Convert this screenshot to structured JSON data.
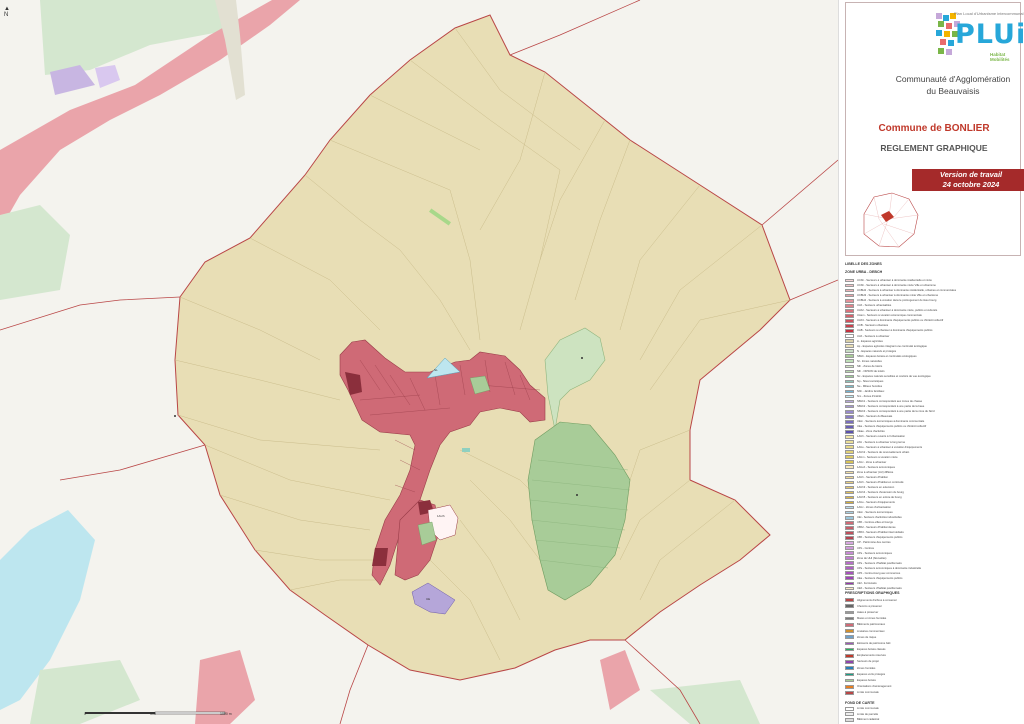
{
  "colors": {
    "background": "#f4f3ee",
    "agricultural": "#e8deb5",
    "urban": "#cf6a76",
    "urban_dark": "#b44c5a",
    "natural": "#cde3c0",
    "forest": "#a8cc98",
    "water": "#bde6ef",
    "boundary": "#b94646",
    "neighbor_urban": "#eaa4aa",
    "neighbor_natural": "#d4e7cf",
    "purple": "#b5a6d9",
    "accent": "#a52a2a"
  },
  "north_arrow": "N",
  "map_labels": {
    "zone_a": "NL",
    "zone_b": "UE",
    "zone_c": "1AUh"
  },
  "scale": {
    "start": "0",
    "mid": "500",
    "end": "1000 m"
  },
  "title_block": {
    "logo_tagline": "Plan Local d'Urbanisme intercommunal",
    "logo_word": "PLUi",
    "logo_sub_1": "Habitat",
    "logo_sub_2": "Mobilités",
    "org_line1": "Communauté d'Agglomération",
    "org_line2": "du Beauvaisis",
    "commune": "Commune de BONLIER",
    "document": "REGLEMENT GRAPHIQUE",
    "version_line1": "Version de travail",
    "version_line2": "24 octobre 2024"
  },
  "legend": {
    "title": "LIBELLE DES ZONES",
    "section_zones": "ZONE URBA - DEBCH",
    "section_prescriptions": "PRESCRIPTIONS GRAPHIQUES",
    "section_fond": "FOND DE CARTE",
    "zones": [
      {
        "color": "#f6d3d6",
        "label": "UCbh - Secteurs à urbaniser à dominante résidentielle et mixte"
      },
      {
        "color": "#f1c2c6",
        "label": "UCbh - Secteurs à urbaniser à dominante mixte Ville et urbanisme"
      },
      {
        "color": "#ecb2b7",
        "label": "UCBH2 - Secteurs à urbaniser à dominante résidentielle, urbaines et commerciales"
      },
      {
        "color": "#e7a1a8",
        "label": "UCBH3 - Secteurs à urbaniser à dominante mixte Ville et urbanisme"
      },
      {
        "color": "#e29199",
        "label": "UCBH4 - Secteurs à vocation dans le prolongement du tissu bourg"
      },
      {
        "color": "#dd818a",
        "label": "UAh - Secteurs urbanisables"
      },
      {
        "color": "#d8717b",
        "label": "UAh2 - Secteurs à urbaniser à dominante mixte, publics et culturels"
      },
      {
        "color": "#d3616c",
        "label": "UAem - Secteurs à vocation économique commerciale"
      },
      {
        "color": "#ce515d",
        "label": "UAh3 - Secteurs à dominante d'équipements publics ou d'intérêt collectif"
      },
      {
        "color": "#c9414e",
        "label": "UCB - Secteurs urbanisés"
      },
      {
        "color": "#c4313f",
        "label": "UAB - Secteurs à urbaniser à dominante d'équipements publics"
      },
      {
        "color": "#ffffff",
        "label": "UAh - Secteurs à urbaniser"
      },
      {
        "color": "#d9d0a8",
        "label": "A - Espaces agricoles"
      },
      {
        "color": "#e8deb5",
        "label": "Ap - Espaces agricoles intégrant une continuité écologique"
      },
      {
        "color": "#c7dcc3",
        "label": "N - Espaces naturels et protégés"
      },
      {
        "color": "#a8cc98",
        "label": "NBoh - Espaces boisés et continuités écologiques"
      },
      {
        "color": "#bfe0b8",
        "label": "Nl - Zones naturelles"
      },
      {
        "color": "#cde3c0",
        "label": "Nlh - Zones de loisirs"
      },
      {
        "color": "#b8d9b0",
        "label": "Nlh - ORSON de loisirs"
      },
      {
        "color": "#9fcf9a",
        "label": "Nc - Espaces naturels sensibles et couloirs de vue écologique"
      },
      {
        "color": "#8bc4b8",
        "label": "Np - Sites touristiques"
      },
      {
        "color": "#7dbec9",
        "label": "Ne - Milieux humides"
      },
      {
        "color": "#6fb3d3",
        "label": "Nbh - Jardins familiaux"
      },
      {
        "color": "#bde6ef",
        "label": "Nm - Zones d'intérêt"
      },
      {
        "color": "#b5a6d9",
        "label": "NBoh1 - Secteurs correspondant aux zones de chasse"
      },
      {
        "color": "#a698d2",
        "label": "NBoh2 - Secteurs correspondant à une partie de la base"
      },
      {
        "color": "#978acb",
        "label": "NBoh3 - Secteurs correspondant à une partie de la zone du Nord"
      },
      {
        "color": "#887cc4",
        "label": "UBeh - Secteurs du Beauvais"
      },
      {
        "color": "#796ebd",
        "label": "UEm - Secteurs économiques à dominante commerciale"
      },
      {
        "color": "#6a60b6",
        "label": "UEe - Secteurs d'équipements publics ou d'intérêt collectif"
      },
      {
        "color": "#5b52af",
        "label": "UEae - Zone d'activités"
      },
      {
        "color": "#f0e6a8",
        "label": "1AUh - Secteurs ouverts à l'urbanisation"
      },
      {
        "color": "#ebdf98",
        "label": "2AU - Secteurs à urbaniser à long terme"
      },
      {
        "color": "#e6d888",
        "label": "1AUe - Secteurs à urbaniser à vocation d'équipements"
      },
      {
        "color": "#e1d178",
        "label": "1AUh2 - Secteurs de renouvellement urbain"
      },
      {
        "color": "#dcca68",
        "label": "1AUm - Secteurs à vocation mixte"
      },
      {
        "color": "#d7c358",
        "label": "1AUc - Zone à urbaniser"
      },
      {
        "color": "#f7e7b9",
        "label": "1AUeh - Secteurs économiques"
      },
      {
        "color": "#f2dfa7",
        "label": "Zone à urbaniser (AU) différée"
      },
      {
        "color": "#edd795",
        "label": "1AUh - Secteurs d'habitat"
      },
      {
        "color": "#e8cf83",
        "label": "1AUh - Secteurs d'habitat en continuité"
      },
      {
        "color": "#e3c771",
        "label": "1AUh3 - Secteurs en extension"
      },
      {
        "color": "#debf5f",
        "label": "1AUh4 - Secteurs d'extension du bourg"
      },
      {
        "color": "#d9b74d",
        "label": "1AUh5 - Secteurs en entrée de bourg"
      },
      {
        "color": "#d4af3b",
        "label": "1AUe - Secteurs d'équipements"
      },
      {
        "color": "#b8d8e8",
        "label": "1AUc - Zones d'urbanisation"
      },
      {
        "color": "#a9cfe2",
        "label": "UEm - Secteurs économiques"
      },
      {
        "color": "#9ac6dc",
        "label": "UEi - Secteurs d'activités industrielles"
      },
      {
        "color": "#cf6a76",
        "label": "UBh - Centres-villes et bourgs"
      },
      {
        "color": "#c75d6a",
        "label": "UBh2 - Secteurs d'habitat dense"
      },
      {
        "color": "#bf505e",
        "label": "UBh3 - Secteurs d'habitat intermédiaire"
      },
      {
        "color": "#b74352",
        "label": "UBh - Secteurs d'équipements publics"
      },
      {
        "color": "#d7a6e0",
        "label": "UP - Patrimoine des centres"
      },
      {
        "color": "#cf98da",
        "label": "UPo - Centres"
      },
      {
        "color": "#c78ad4",
        "label": "UPe - Secteurs économiques"
      },
      {
        "color": "#bf7cce",
        "label": "Zone de UHl (Nouvelles)"
      },
      {
        "color": "#b76ec8",
        "label": "UPe - Secteurs d'habitat pavillonnaire"
      },
      {
        "color": "#af60c2",
        "label": "UPe - Secteurs économiques à dominante industrielle"
      },
      {
        "color": "#a752bc",
        "label": "UPb - Centre-bourg aux commerces"
      },
      {
        "color": "#9f44b6",
        "label": "UEe - Secteurs d'équipements publics"
      },
      {
        "color": "#9736b0",
        "label": "UEf - Ferroviaire"
      },
      {
        "color": "#fde9c9",
        "label": "UEh - Secteurs d'habitat pavillonnaire"
      }
    ],
    "prescriptions": [
      {
        "color": "#b94646",
        "label": "Alignements d'arbres à conserver"
      },
      {
        "color": "#666666",
        "label": "Chemins à préserver"
      },
      {
        "color": "#999999",
        "label": "Haies à préserver"
      },
      {
        "color": "#7a7a7a",
        "label": "Mares et zones humides"
      },
      {
        "color": "#cf6a76",
        "label": "Bâtiments patrimoniaux"
      },
      {
        "color": "#d08f2e",
        "label": "Linéaires commerciaux"
      },
      {
        "color": "#6fa0c8",
        "label": "Zones de risque"
      },
      {
        "color": "#9b59b6",
        "label": "Éléments de patrimoine bâti"
      },
      {
        "color": "#27ae60",
        "label": "Espaces boisés classés"
      },
      {
        "color": "#c0392b",
        "label": "Emplacements réservés"
      },
      {
        "color": "#8e44ad",
        "label": "Secteurs de projet"
      },
      {
        "color": "#2980b9",
        "label": "Zones humides"
      },
      {
        "color": "#16a085",
        "label": "Espaces verts protégés"
      },
      {
        "color": "#a8cc98",
        "label": "Espaces boisés"
      },
      {
        "color": "#e67e22",
        "label": "Orientations d'aménagement"
      },
      {
        "color": "#b94646",
        "label": "Limite communale"
      }
    ],
    "fond": [
      {
        "color": "#ffffff",
        "label": "Limite communale"
      },
      {
        "color": "#eeeeee",
        "label": "Limite de parcelle"
      },
      {
        "color": "#dddddd",
        "label": "Bâtiment cadastral"
      }
    ]
  }
}
